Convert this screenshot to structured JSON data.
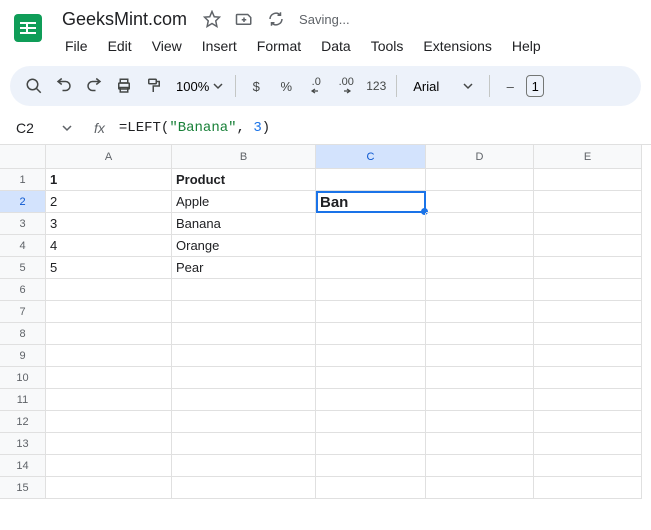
{
  "doc": {
    "title": "GeeksMint.com",
    "saving": "Saving..."
  },
  "menu": {
    "m0": "File",
    "m1": "Edit",
    "m2": "View",
    "m3": "Insert",
    "m4": "Format",
    "m5": "Data",
    "m6": "Tools",
    "m7": "Extensions",
    "m8": "Help"
  },
  "toolbar": {
    "zoom": "100%",
    "currency": "$",
    "percent": "%",
    "dec_dec": ".0",
    "dec_inc": ".00",
    "fmt123": "123",
    "font": "Arial",
    "minus": "–",
    "fontsize_partial": "1"
  },
  "formulabar": {
    "cellref": "C2",
    "formula_prefix": "=LEFT(",
    "formula_str": "\"Banana\"",
    "formula_comma": ", ",
    "formula_num": "3",
    "formula_suffix": ")"
  },
  "cols": {
    "c0": "A",
    "c1": "B",
    "c2": "C",
    "c3": "D",
    "c4": "E"
  },
  "rows": {
    "r1": "1",
    "r2": "2",
    "r3": "3",
    "r4": "4",
    "r5": "5",
    "r6": "6",
    "r7": "7",
    "r8": "8",
    "r9": "9",
    "r10": "10",
    "r11": "11",
    "r12": "12",
    "r13": "13",
    "r14": "14",
    "r15": "15"
  },
  "cells": {
    "A1": "1",
    "B1": "Product",
    "A2": "2",
    "B2": "Apple",
    "C2": "Ban",
    "A3": "3",
    "B3": "Banana",
    "A4": "4",
    "B4": "Orange",
    "A5": "5",
    "B5": "Pear"
  }
}
